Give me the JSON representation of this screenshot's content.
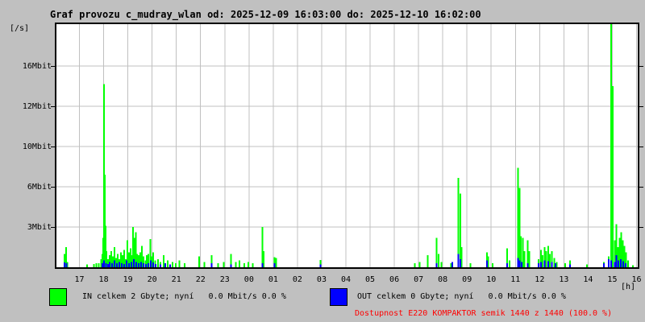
{
  "title": "Graf provozu c_mudray_wlan od: 2025-12-09 16:03:00 do: 2025-12-10 16:02:00",
  "colors": {
    "background": "#c0c0c0",
    "plot_background": "#ffffff",
    "grid": "#c0c0c0",
    "in_series": "#00ff00",
    "out_series": "#0000ff",
    "availability": "#ff0000",
    "text": "#000000"
  },
  "legend": {
    "in_label": "IN celkem 2 Gbyte; nyní   0.0 Mbit/s 0.0 %",
    "out_label": "OUT celkem 0 Gbyte; nyní   0.0 Mbit/s 0.0 %"
  },
  "availability_text": "Dostupnost E220 KOMPAKTOR semik 1440 z 1440 (100.0 %)",
  "chart_data": {
    "type": "bar",
    "title": "Graf provozu c_mudray_wlan od: 2025-12-09 16:03:00 do: 2025-12-10 16:02:00",
    "time_start": "2025-12-09 16:03:00",
    "time_end": "2025-12-10 16:02:00",
    "y_unit": "[/s]",
    "x_unit": "[h]",
    "grid": true,
    "y_ticks": [
      {
        "label": "16Mbit",
        "value": 16
      },
      {
        "label": "12Mbit",
        "value": 12
      },
      {
        "label": "10Mbit",
        "value": 10
      },
      {
        "label": "6Mbit",
        "value": 6
      },
      {
        "label": "3Mbit",
        "value": 3
      }
    ],
    "ylim": [
      0,
      17.5
    ],
    "x_ticks": [
      "17",
      "18",
      "19",
      "20",
      "21",
      "22",
      "23",
      "00",
      "01",
      "02",
      "03",
      "04",
      "05",
      "06",
      "07",
      "08",
      "09",
      "10",
      "11",
      "12",
      "13",
      "14",
      "15",
      "16"
    ],
    "x_first_tick_offset_hours": 0.95,
    "x_range_hours": 24,
    "series": [
      {
        "name": "IN",
        "color": "#00ff00",
        "unit": "Mbit/s",
        "points": [
          [
            0.33,
            1.0
          ],
          [
            0.4,
            1.5
          ],
          [
            0.45,
            0.4
          ],
          [
            1.27,
            0.2
          ],
          [
            1.55,
            0.25
          ],
          [
            1.65,
            0.3
          ],
          [
            1.75,
            0.3
          ],
          [
            1.85,
            0.6
          ],
          [
            1.9,
            1.0
          ],
          [
            1.93,
            2.2
          ],
          [
            1.97,
            14.2
          ],
          [
            2.0,
            7.2
          ],
          [
            2.03,
            3.1
          ],
          [
            2.07,
            1.2
          ],
          [
            2.13,
            0.6
          ],
          [
            2.2,
            0.9
          ],
          [
            2.27,
            1.2
          ],
          [
            2.33,
            0.8
          ],
          [
            2.4,
            1.5
          ],
          [
            2.47,
            0.7
          ],
          [
            2.53,
            1.0
          ],
          [
            2.6,
            0.6
          ],
          [
            2.67,
            1.1
          ],
          [
            2.73,
            0.9
          ],
          [
            2.8,
            1.3
          ],
          [
            2.87,
            0.6
          ],
          [
            2.93,
            2.0
          ],
          [
            3.0,
            1.1
          ],
          [
            3.07,
            1.4
          ],
          [
            3.13,
            0.9
          ],
          [
            3.17,
            3.0
          ],
          [
            3.22,
            2.2
          ],
          [
            3.28,
            2.6
          ],
          [
            3.33,
            1.0
          ],
          [
            3.4,
            0.9
          ],
          [
            3.47,
            1.1
          ],
          [
            3.53,
            1.6
          ],
          [
            3.6,
            0.8
          ],
          [
            3.67,
            0.5
          ],
          [
            3.73,
            0.9
          ],
          [
            3.8,
            1.0
          ],
          [
            3.87,
            2.1
          ],
          [
            3.93,
            0.8
          ],
          [
            4.0,
            1.1
          ],
          [
            4.07,
            0.5
          ],
          [
            4.2,
            0.6
          ],
          [
            4.3,
            0.4
          ],
          [
            4.43,
            0.9
          ],
          [
            4.6,
            0.5
          ],
          [
            4.8,
            0.4
          ],
          [
            4.93,
            0.3
          ],
          [
            5.07,
            0.5
          ],
          [
            5.3,
            0.3
          ],
          [
            5.9,
            0.8
          ],
          [
            6.1,
            0.4
          ],
          [
            6.4,
            0.9
          ],
          [
            6.67,
            0.3
          ],
          [
            6.9,
            0.4
          ],
          [
            7.2,
            1.0
          ],
          [
            7.4,
            0.4
          ],
          [
            7.55,
            0.5
          ],
          [
            7.75,
            0.3
          ],
          [
            7.93,
            0.4
          ],
          [
            8.1,
            0.3
          ],
          [
            8.5,
            3.0
          ],
          [
            8.55,
            1.2
          ],
          [
            9.0,
            0.75
          ],
          [
            9.07,
            0.7
          ],
          [
            10.9,
            0.55
          ],
          [
            14.8,
            0.3
          ],
          [
            15.0,
            0.4
          ],
          [
            15.33,
            0.9
          ],
          [
            15.7,
            2.2
          ],
          [
            15.77,
            1.0
          ],
          [
            15.9,
            0.4
          ],
          [
            16.3,
            0.3
          ],
          [
            16.6,
            6.9
          ],
          [
            16.67,
            5.5
          ],
          [
            16.72,
            1.5
          ],
          [
            17.1,
            0.3
          ],
          [
            17.77,
            1.1
          ],
          [
            17.83,
            0.8
          ],
          [
            18.0,
            0.3
          ],
          [
            18.6,
            1.4
          ],
          [
            18.7,
            0.5
          ],
          [
            19.05,
            7.9
          ],
          [
            19.12,
            5.9
          ],
          [
            19.18,
            2.3
          ],
          [
            19.25,
            2.2
          ],
          [
            19.32,
            1.2
          ],
          [
            19.45,
            2.0
          ],
          [
            19.52,
            1.2
          ],
          [
            19.9,
            0.6
          ],
          [
            20.0,
            1.3
          ],
          [
            20.08,
            0.9
          ],
          [
            20.15,
            1.5
          ],
          [
            20.22,
            1.2
          ],
          [
            20.3,
            1.6
          ],
          [
            20.38,
            1.0
          ],
          [
            20.45,
            1.2
          ],
          [
            20.55,
            0.7
          ],
          [
            20.65,
            0.4
          ],
          [
            21.0,
            0.3
          ],
          [
            21.2,
            0.5
          ],
          [
            21.9,
            0.2
          ],
          [
            22.6,
            0.4
          ],
          [
            22.8,
            0.8
          ],
          [
            22.9,
            17.5
          ],
          [
            22.97,
            14.0
          ],
          [
            23.05,
            2.0
          ],
          [
            23.12,
            3.2
          ],
          [
            23.18,
            1.5
          ],
          [
            23.25,
            2.2
          ],
          [
            23.32,
            2.6
          ],
          [
            23.38,
            2.0
          ],
          [
            23.45,
            1.6
          ],
          [
            23.52,
            1.1
          ],
          [
            23.6,
            0.5
          ],
          [
            23.8,
            0.15
          ]
        ]
      },
      {
        "name": "OUT",
        "color": "#0000ff",
        "unit": "Mbit/s",
        "points": [
          [
            0.33,
            0.35
          ],
          [
            0.42,
            0.3
          ],
          [
            1.9,
            0.3
          ],
          [
            1.97,
            0.5
          ],
          [
            2.05,
            0.3
          ],
          [
            2.13,
            0.25
          ],
          [
            2.2,
            0.4
          ],
          [
            2.3,
            0.3
          ],
          [
            2.4,
            0.5
          ],
          [
            2.5,
            0.3
          ],
          [
            2.6,
            0.4
          ],
          [
            2.7,
            0.3
          ],
          [
            2.8,
            0.25
          ],
          [
            2.9,
            0.5
          ],
          [
            3.0,
            0.3
          ],
          [
            3.1,
            0.4
          ],
          [
            3.2,
            0.6
          ],
          [
            3.3,
            0.4
          ],
          [
            3.4,
            0.3
          ],
          [
            3.5,
            0.4
          ],
          [
            3.6,
            0.3
          ],
          [
            3.7,
            0.25
          ],
          [
            3.8,
            0.3
          ],
          [
            3.9,
            0.5
          ],
          [
            4.0,
            0.35
          ],
          [
            4.1,
            0.25
          ],
          [
            4.3,
            0.2
          ],
          [
            4.5,
            0.3
          ],
          [
            4.7,
            0.2
          ],
          [
            6.4,
            0.3
          ],
          [
            7.2,
            0.2
          ],
          [
            8.5,
            0.3
          ],
          [
            9.0,
            0.3
          ],
          [
            10.9,
            0.2
          ],
          [
            15.7,
            0.3
          ],
          [
            16.35,
            0.4
          ],
          [
            16.6,
            1.0
          ],
          [
            16.67,
            0.6
          ],
          [
            17.77,
            0.5
          ],
          [
            18.6,
            0.3
          ],
          [
            19.05,
            0.7
          ],
          [
            19.12,
            0.5
          ],
          [
            19.2,
            0.4
          ],
          [
            19.45,
            0.3
          ],
          [
            19.9,
            0.3
          ],
          [
            20.0,
            0.4
          ],
          [
            20.15,
            0.5
          ],
          [
            20.3,
            0.45
          ],
          [
            20.45,
            0.4
          ],
          [
            20.6,
            0.3
          ],
          [
            21.2,
            0.2
          ],
          [
            22.6,
            0.3
          ],
          [
            22.8,
            0.6
          ],
          [
            22.9,
            0.5
          ],
          [
            23.05,
            0.4
          ],
          [
            23.12,
            0.9
          ],
          [
            23.2,
            0.5
          ],
          [
            23.3,
            0.6
          ],
          [
            23.4,
            0.45
          ],
          [
            23.5,
            0.3
          ]
        ]
      }
    ]
  }
}
